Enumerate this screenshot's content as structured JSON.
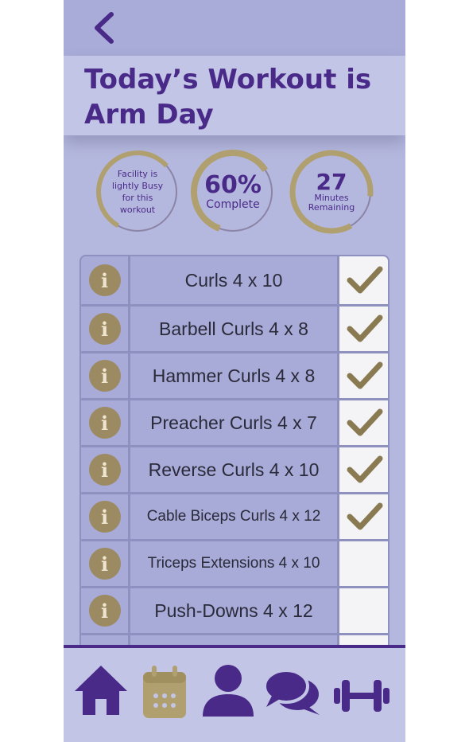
{
  "header": {
    "back_icon": "chevron-left-icon",
    "title": "Today’s Workout is Arm Day"
  },
  "stats": {
    "facility": {
      "text": "Facility is lightly Busy for this workout",
      "level": 0.55
    },
    "progress": {
      "value": "60%",
      "label": "Complete",
      "level": 0.6
    },
    "time": {
      "value": "27",
      "label": "Minutes Remaining",
      "level": 0.85
    }
  },
  "exercises": [
    {
      "name": "Curls 4 x 10",
      "done": true
    },
    {
      "name": "Barbell Curls 4 x 8",
      "done": true
    },
    {
      "name": "Hammer Curls 4 x 8",
      "done": true
    },
    {
      "name": "Preacher Curls 4 x 7",
      "done": true
    },
    {
      "name": "Reverse Curls 4 x 10",
      "done": true
    },
    {
      "name": "Cable Biceps Curls 4 x 12",
      "done": true
    },
    {
      "name": "Triceps Extensions 4 x 10",
      "done": false
    },
    {
      "name": "Push-Downs 4 x 12",
      "done": false
    }
  ],
  "info_glyph": "i",
  "nav": {
    "items": [
      {
        "icon": "home-icon",
        "active": false
      },
      {
        "icon": "calendar-icon",
        "active": true
      },
      {
        "icon": "profile-icon",
        "active": false
      },
      {
        "icon": "chat-icon",
        "active": false
      },
      {
        "icon": "dumbbell-icon",
        "active": false
      }
    ]
  },
  "colors": {
    "accent": "#4a2a88",
    "gold": "#a89870",
    "background": "#b5b8de",
    "header": "#a9acd8",
    "check": "#8a7a52"
  }
}
